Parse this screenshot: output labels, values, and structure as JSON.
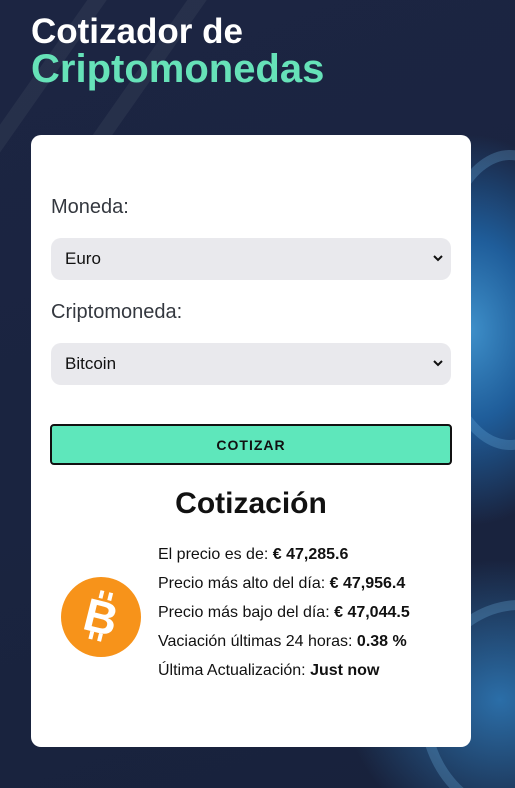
{
  "header": {
    "title_line1": "Cotizador de",
    "title_line2": "Criptomonedas"
  },
  "form": {
    "currency_label": "Moneda:",
    "currency_selected": "Euro",
    "crypto_label": "Criptomoneda:",
    "crypto_selected": "Bitcoin",
    "submit_label": "COTIZAR"
  },
  "result": {
    "title": "Cotización",
    "coin_icon": "bitcoin-icon",
    "rows": [
      {
        "label": "El precio es de: ",
        "value": "€ 47,285.6"
      },
      {
        "label": "Precio más alto del día: ",
        "value": "€ 47,956.4"
      },
      {
        "label": "Precio más bajo del día: ",
        "value": "€ 47,044.5"
      },
      {
        "label": "Vaciación últimas 24 horas: ",
        "value": "0.38 %"
      },
      {
        "label": "Última Actualización: ",
        "value": "Just now"
      }
    ]
  },
  "colors": {
    "background": "#1b2540",
    "accent": "#5ee7bb",
    "title_accent": "#66e2b8",
    "bitcoin_orange": "#f7931a"
  }
}
